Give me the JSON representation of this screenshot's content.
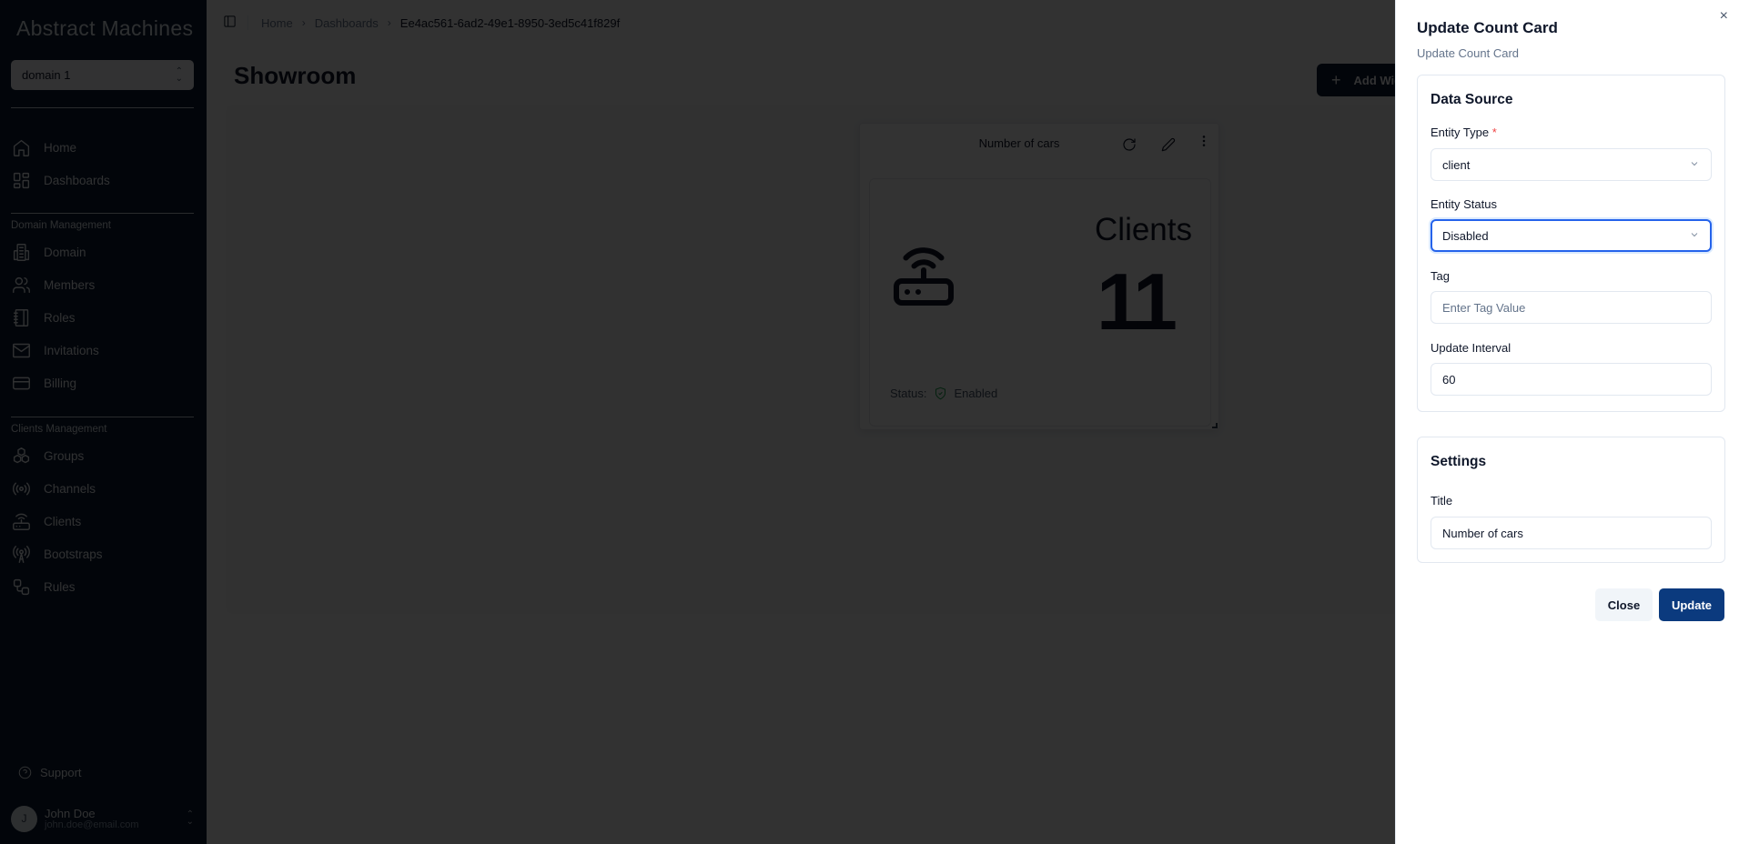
{
  "sidebar": {
    "logo": "Abstract Machines",
    "domain_selector": "domain 1",
    "top_items": [
      {
        "label": "Home",
        "icon": "home-icon"
      },
      {
        "label": "Dashboards",
        "icon": "dashboard-icon"
      }
    ],
    "domain_group_label": "Domain Management",
    "domain_items": [
      {
        "label": "Domain",
        "icon": "building-icon"
      },
      {
        "label": "Members",
        "icon": "users-icon"
      },
      {
        "label": "Roles",
        "icon": "notebook-icon"
      },
      {
        "label": "Invitations",
        "icon": "mail-icon"
      },
      {
        "label": "Billing",
        "icon": "credit-card-icon"
      }
    ],
    "clients_group_label": "Clients Management",
    "clients_items": [
      {
        "label": "Groups",
        "icon": "boxes-icon"
      },
      {
        "label": "Channels",
        "icon": "radio-icon"
      },
      {
        "label": "Clients",
        "icon": "router-icon"
      },
      {
        "label": "Bootstraps",
        "icon": "antenna-icon"
      },
      {
        "label": "Rules",
        "icon": "workflow-icon"
      }
    ],
    "support_label": "Support",
    "user": {
      "initial": "J",
      "name": "John Doe",
      "email": "john.doe@email.com"
    }
  },
  "header": {
    "breadcrumbs": [
      "Home",
      "Dashboards"
    ],
    "current_crumb": "Ee4ac561-6ad2-49e1-8950-3ed5c41f829f",
    "separator": "›"
  },
  "page": {
    "title": "Showroom",
    "add_widget_label": "Add Widget"
  },
  "widget": {
    "title": "Number of cars",
    "entity_label": "Clients",
    "count": "11",
    "status_label": "Status:",
    "status_value": "Enabled"
  },
  "drawer": {
    "title": "Update Count Card",
    "subtitle": "Update Count Card",
    "close_glyph": "×",
    "data_source": {
      "heading": "Data Source",
      "entity_type_label": "Entity Type",
      "required_marker": "*",
      "entity_type_value": "client",
      "entity_status_label": "Entity Status",
      "entity_status_value": "Disabled",
      "tag_label": "Tag",
      "tag_placeholder": "Enter Tag Value",
      "tag_value": "",
      "interval_label": "Update Interval",
      "interval_value": "60"
    },
    "settings": {
      "heading": "Settings",
      "title_label": "Title",
      "title_value": "Number of cars"
    },
    "close_button": "Close",
    "update_button": "Update"
  },
  "colors": {
    "sidebar_bg": "#0a1a33",
    "primary_button": "#0b3a7e",
    "focus_ring": "#2563eb",
    "required": "#ef4444",
    "status_enabled": "#16a34a"
  }
}
